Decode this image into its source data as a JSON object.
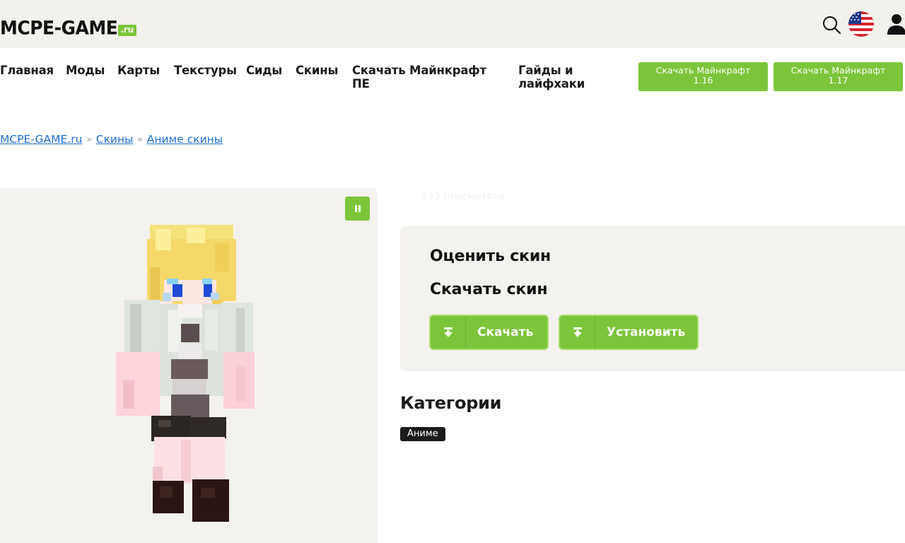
{
  "header": {
    "logo_text": "MCPE-GAME",
    "logo_suffix": ".ru"
  },
  "icons": {
    "search": "search-icon",
    "language": "us-flag-icon",
    "user": "user-icon",
    "pause": "pause-icon",
    "download": "download-icon"
  },
  "nav": {
    "items": [
      {
        "label": "Главная"
      },
      {
        "label": "Моды"
      },
      {
        "label": "Карты"
      },
      {
        "label": "Текстуры"
      },
      {
        "label": "Сиды"
      },
      {
        "label": "Скины"
      },
      {
        "label_line1": "Скачать Майнкрафт",
        "label_line2": "ПЕ"
      },
      {
        "label_line1": "Гайды и",
        "label_line2": "лайфхаки"
      }
    ],
    "buttons": [
      {
        "line1": "Скачать Майнкрафт",
        "line2": "1.16"
      },
      {
        "line1": "Скачать Майнкрафт",
        "line2": "1.17"
      }
    ]
  },
  "breadcrumb": {
    "items": [
      "MCPE-GAME.ru",
      "Скины",
      "Аниме скины"
    ],
    "separator": "»"
  },
  "preview": {
    "views_text": "143 просмотров"
  },
  "panel": {
    "rate_title": "Оценить скин",
    "download_title": "Скачать скин",
    "download_label": "Скачать",
    "install_label": "Установить"
  },
  "categories": {
    "title": "Категории",
    "tags": [
      "Аниме"
    ]
  },
  "colors": {
    "accent": "#7cc53a",
    "header_bg": "#f3f1ec",
    "panel_bg": "#f4f2ee",
    "link": "#1f6fd1",
    "dark": "#1b1b1b"
  }
}
